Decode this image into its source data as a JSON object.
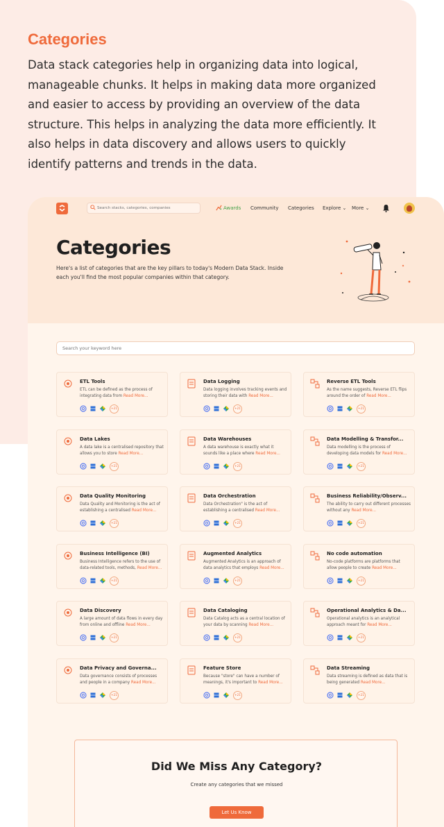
{
  "intro": {
    "title": "Categories",
    "text": "Data stack categories help in organizing data into logical, manageable chunks. It helps in making data more organized and easier to access by providing an overview of the data structure. This helps in analyzing the data more efficiently. It also helps in data discovery and allows users to quickly identify patterns and trends in the data."
  },
  "colors": {
    "accent": "#ef6a3b",
    "hero_bg": "#fde8d8",
    "page_bg": "#fff5ec",
    "awards": "#43a047"
  },
  "nav": {
    "search_placeholder": "Search stacks, categories, companies",
    "awards": "Awards",
    "community": "Community",
    "categories": "Categories",
    "explore": "Explore",
    "more": "More"
  },
  "hero": {
    "title": "Categories",
    "subtitle": "Here's a list of categories that are the key pillars to today's Modern Data Stack. Inside each you'll find the most popular companies within that category."
  },
  "keyword_search": {
    "placeholder": "Search your keyword here"
  },
  "read_more": "Read More...",
  "cards": [
    {
      "title": "ETL Tools",
      "desc": "ETL can be defined as the process of integrating data from",
      "more": "+21",
      "icon": "etl-icon"
    },
    {
      "title": "Data Logging",
      "desc": "Data logging involves tracking events and storing their data with",
      "more": "+21",
      "icon": "logging-icon"
    },
    {
      "title": "Reverse ETL Tools",
      "desc": "As the name suggests, Reverse ETL flips around the order of",
      "more": "+21",
      "icon": "reverse-etl-icon"
    },
    {
      "title": "Data Lakes",
      "desc": "A data lake is a centralised repository that allows you to store",
      "more": "+21",
      "icon": "data-lake-icon"
    },
    {
      "title": "Data Warehouses",
      "desc": "A data warehouse is exactly what it sounds like a place where",
      "more": "+21",
      "icon": "warehouse-icon"
    },
    {
      "title": "Data Modelling & Transfor...",
      "desc": "Data modelling is the process of developing data models for",
      "more": "+21",
      "icon": "modelling-icon"
    },
    {
      "title": "Data Quality Monitoring",
      "desc": "Data Quality and Monitoring is the act of establishing a centralised",
      "more": "+21",
      "icon": "quality-icon"
    },
    {
      "title": "Data Orchestration",
      "desc": "Data Orchestration\" is the act of establishing a centralised",
      "more": "+21",
      "icon": "orchestration-icon"
    },
    {
      "title": "Business Reliability/Observ...",
      "desc": "The ability to carry out different processes without any",
      "more": "+21",
      "icon": "reliability-icon"
    },
    {
      "title": "Business Intelligence (BI)",
      "desc": "Business Intelligence refers to the use of data-related tools, methods,",
      "more": "+21",
      "icon": "bi-icon"
    },
    {
      "title": "Augmented Analytics",
      "desc": "Augmented Analytics is an approach of data analytics that employs",
      "more": "+21",
      "icon": "augmented-icon"
    },
    {
      "title": "No code automation",
      "desc": "No-code platforms are platforms that allow people to create",
      "more": "+21",
      "icon": "no-code-icon"
    },
    {
      "title": "Data Discovery",
      "desc": "A large amount of data flows in every day from online and offline",
      "more": "+21",
      "icon": "discovery-icon"
    },
    {
      "title": "Data Cataloging",
      "desc": "Data Catalog acts as a central location of your data by scanning",
      "more": "+21",
      "icon": "catalog-icon"
    },
    {
      "title": "Operational Analytics & Da...",
      "desc": "Operational analytics is an analytical approach meant for",
      "more": "+21",
      "icon": "operational-icon"
    },
    {
      "title": "Data Privacy and Governa...",
      "desc": "Data governance consists of processes and people in a company",
      "more": "+21",
      "icon": "privacy-icon"
    },
    {
      "title": "Feature Store",
      "desc": "Because \"store\" can have a number of meanings, it's important to",
      "more": "+21",
      "icon": "feature-store-icon"
    },
    {
      "title": "Data Streaming",
      "desc": "Data streaming is defined as data that is being generated",
      "more": "+21",
      "icon": "streaming-icon"
    }
  ],
  "cta": {
    "title": "Did We Miss Any Category?",
    "subtitle": "Create any categories that we missed",
    "button": "Let Us Know"
  }
}
